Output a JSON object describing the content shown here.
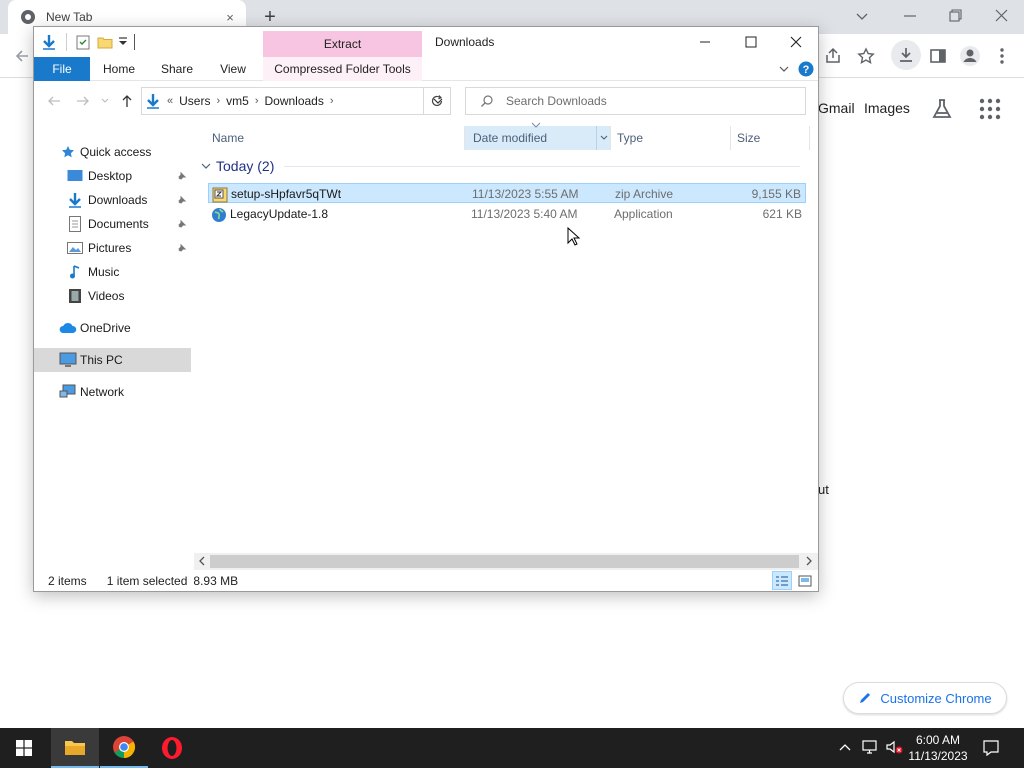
{
  "chrome": {
    "tab_title": "New Tab",
    "tab_close": "×",
    "new_tab": "+",
    "gmail": "Gmail",
    "images": "Images",
    "partial_text": "ut",
    "customize_label": "Customize Chrome"
  },
  "explorer": {
    "title": "Downloads",
    "context_tab": "Extract",
    "ribbon_tabs": [
      "File",
      "Home",
      "Share",
      "View",
      "Compressed Folder Tools"
    ],
    "address": {
      "overflow": "«",
      "crumbs": [
        "Users",
        "vm5",
        "Downloads"
      ]
    },
    "search_placeholder": "Search Downloads",
    "nav": {
      "quick_access": "Quick access",
      "desktop": "Desktop",
      "downloads": "Downloads",
      "documents": "Documents",
      "pictures": "Pictures",
      "music": "Music",
      "videos": "Videos",
      "onedrive": "OneDrive",
      "this_pc": "This PC",
      "network": "Network"
    },
    "columns": {
      "name": "Name",
      "date": "Date modified",
      "type": "Type",
      "size": "Size"
    },
    "group_label": "Today (2)",
    "files": [
      {
        "name": "setup-sHpfavr5qTWt",
        "date": "11/13/2023 5:55 AM",
        "type": "zip Archive",
        "size": "9,155 KB"
      },
      {
        "name": "LegacyUpdate-1.8",
        "date": "11/13/2023 5:40 AM",
        "type": "Application",
        "size": "621 KB"
      }
    ],
    "status": {
      "items": "2 items",
      "selected": "1 item selected",
      "size": "8.93 MB"
    }
  },
  "taskbar": {
    "time": "6:00 AM",
    "date": "11/13/2023"
  },
  "colors": {
    "file_tab": "#1979ca",
    "context_tab": "#f7c5e1",
    "selection": "#cce8ff",
    "nav_selected": "#d9d9d9",
    "taskbar": "#1f1f1f"
  }
}
